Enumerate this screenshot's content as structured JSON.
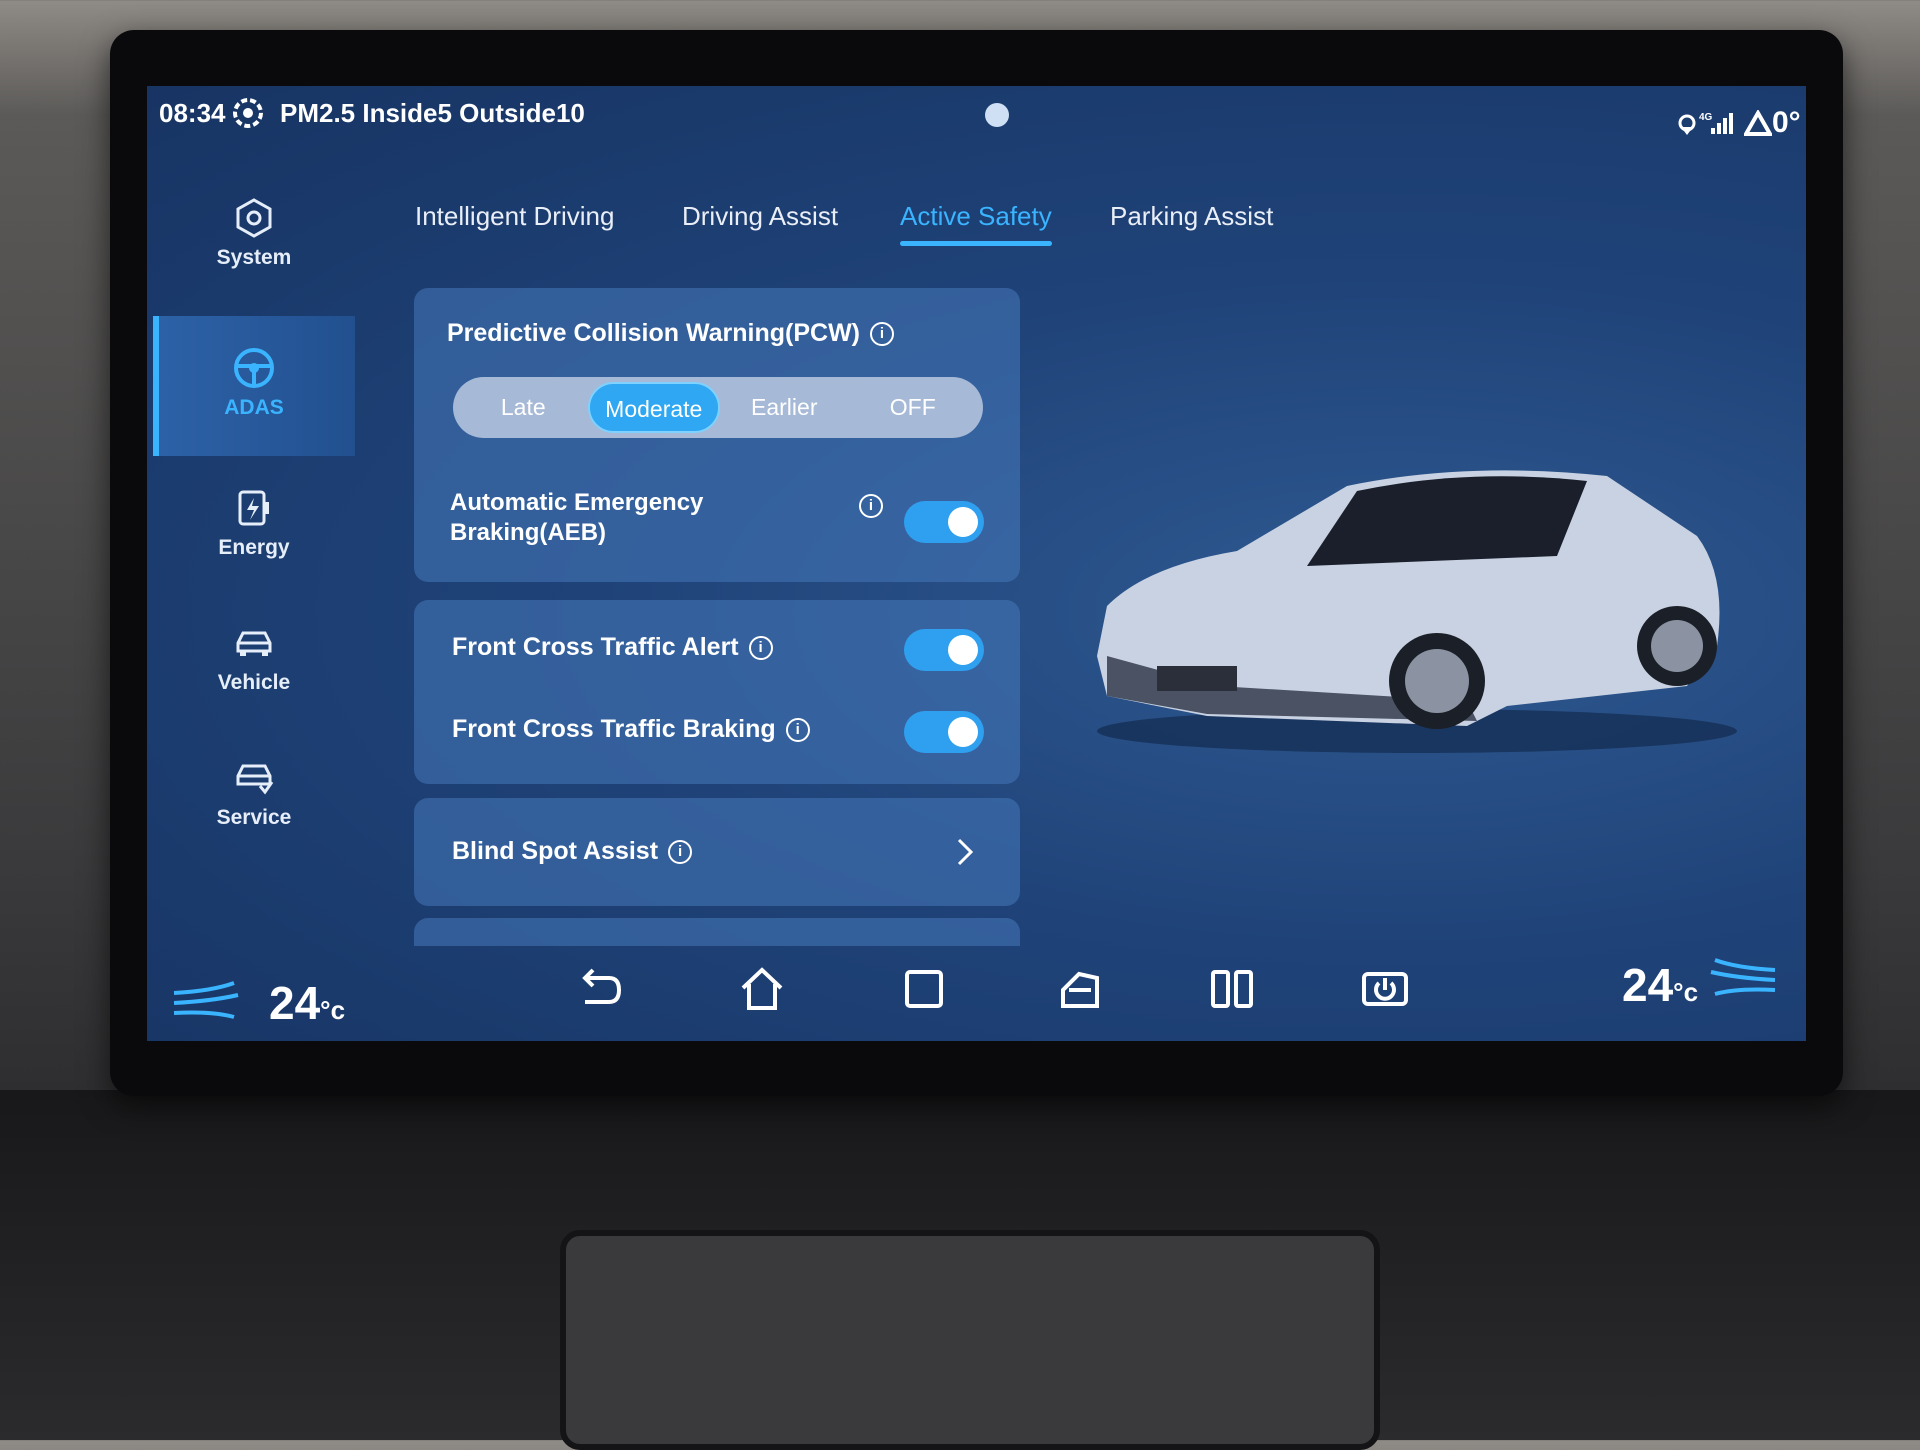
{
  "status_bar": {
    "time": "08:34",
    "air_quality": "PM2.5 Inside5 Outside10",
    "temperature": "0°",
    "network": "4G"
  },
  "sidebar": {
    "items": [
      {
        "label": "System",
        "icon": "gear-icon"
      },
      {
        "label": "ADAS",
        "icon": "steering-wheel-icon",
        "active": true
      },
      {
        "label": "Energy",
        "icon": "battery-icon"
      },
      {
        "label": "Vehicle",
        "icon": "car-icon"
      },
      {
        "label": "Service",
        "icon": "car-service-icon"
      }
    ]
  },
  "tabs": [
    {
      "label": "Intelligent Driving"
    },
    {
      "label": "Driving Assist"
    },
    {
      "label": "Active Safety",
      "active": true
    },
    {
      "label": "Parking Assist"
    }
  ],
  "pcw": {
    "title": "Predictive Collision Warning(PCW)",
    "options": [
      "Late",
      "Moderate",
      "Earlier",
      "OFF"
    ],
    "selected": "Moderate"
  },
  "aeb": {
    "label": "Automatic Emergency Braking(AEB)",
    "enabled": true
  },
  "fcta": {
    "label": "Front Cross Traffic Alert",
    "enabled": true
  },
  "fctb": {
    "label": "Front Cross Traffic Braking",
    "enabled": true
  },
  "bsa": {
    "label": "Blind Spot Assist"
  },
  "climate": {
    "left_temp": "24",
    "right_temp": "24",
    "unit": "°c"
  },
  "colors": {
    "accent": "#3ab4ff",
    "screen_bg": "#1f4379",
    "card": "#4678b9"
  }
}
